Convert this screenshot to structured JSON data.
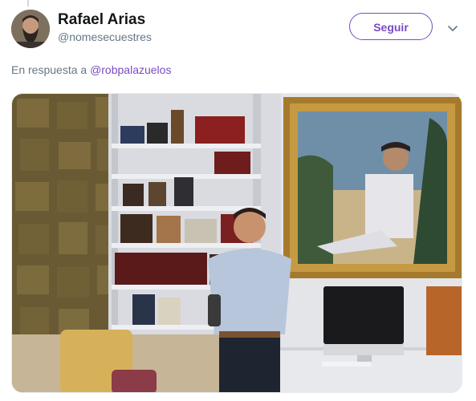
{
  "tweet": {
    "display_name": "Rafael Arias",
    "handle": "@nomesecuestres",
    "follow_label": "Seguir",
    "reply_prefix": "En respuesta a",
    "reply_mention": "@robpalazuelos"
  },
  "colors": {
    "accent": "#794bc4",
    "secondary_text": "#657786",
    "primary_text": "#14171a"
  },
  "icons": {
    "menu": "chevron-down-icon"
  }
}
